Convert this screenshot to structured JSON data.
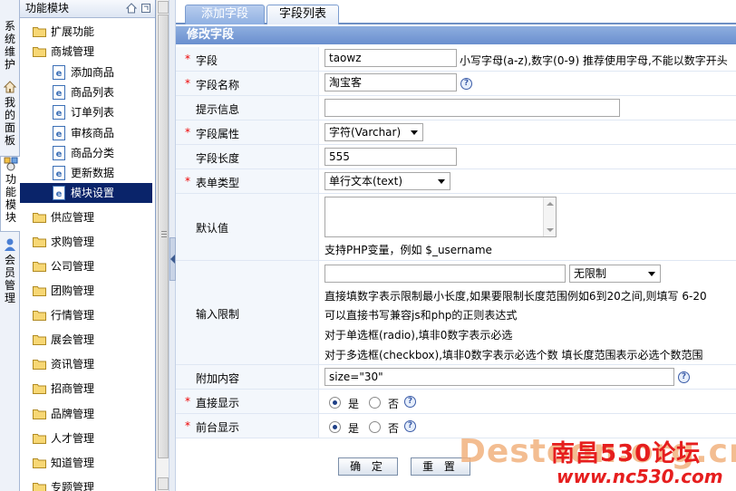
{
  "side_tabs": [
    {
      "label": "系统维护"
    },
    {
      "label": "我的面板"
    },
    {
      "label": "功能模块"
    },
    {
      "label": "会员管理"
    }
  ],
  "tree": {
    "title": "功能模块",
    "items": [
      {
        "label": "扩展功能",
        "type": "folder",
        "level": 0
      },
      {
        "label": "商城管理",
        "type": "folder",
        "level": 0
      },
      {
        "label": "添加商品",
        "type": "page",
        "level": 1
      },
      {
        "label": "商品列表",
        "type": "page",
        "level": 1
      },
      {
        "label": "订单列表",
        "type": "page",
        "level": 1
      },
      {
        "label": "审核商品",
        "type": "page",
        "level": 1
      },
      {
        "label": "商品分类",
        "type": "page",
        "level": 1
      },
      {
        "label": "更新数据",
        "type": "page",
        "level": 1
      },
      {
        "label": "模块设置",
        "type": "page",
        "level": 1,
        "selected": true
      },
      {
        "label": "供应管理",
        "type": "folder",
        "level": 0
      },
      {
        "label": "求购管理",
        "type": "folder",
        "level": 0
      },
      {
        "label": "公司管理",
        "type": "folder",
        "level": 0
      },
      {
        "label": "团购管理",
        "type": "folder",
        "level": 0
      },
      {
        "label": "行情管理",
        "type": "folder",
        "level": 0
      },
      {
        "label": "展会管理",
        "type": "folder",
        "level": 0
      },
      {
        "label": "资讯管理",
        "type": "folder",
        "level": 0
      },
      {
        "label": "招商管理",
        "type": "folder",
        "level": 0
      },
      {
        "label": "品牌管理",
        "type": "folder",
        "level": 0
      },
      {
        "label": "人才管理",
        "type": "folder",
        "level": 0
      },
      {
        "label": "知道管理",
        "type": "folder",
        "level": 0
      },
      {
        "label": "专题管理",
        "type": "folder",
        "level": 0
      }
    ]
  },
  "tabs": [
    {
      "label": "添加字段"
    },
    {
      "label": "字段列表"
    }
  ],
  "section_title": "修改字段",
  "form": {
    "field": {
      "label": "字段",
      "value": "taowz",
      "hint": "小写字母(a-z),数字(0-9) 推荐使用字母,不能以数字开头"
    },
    "field_name": {
      "label": "字段名称",
      "value": "淘宝客"
    },
    "tip": {
      "label": "提示信息",
      "value": ""
    },
    "attr": {
      "label": "字段属性",
      "value": "字符(Varchar)"
    },
    "length": {
      "label": "字段长度",
      "value": "555"
    },
    "form_type": {
      "label": "表单类型",
      "value": "单行文本(text)"
    },
    "default": {
      "label": "默认值",
      "hint": "支持PHP变量，例如 $_username"
    },
    "limit": {
      "label": "输入限制",
      "select_value": "无限制",
      "hints": [
        "直接填数字表示限制最小长度,如果要限制长度范围例如6到20之间,则填写  6-20",
        "可以直接书写兼容js和php的正则表达式",
        "对于单选框(radio),填非0数字表示必选",
        "对于多选框(checkbox),填非0数字表示必选个数 填长度范围表示必选个数范围"
      ]
    },
    "extra": {
      "label": "附加内容",
      "value": "size=\"30\""
    },
    "direct_show": {
      "label": "直接显示",
      "yes": "是",
      "no": "否"
    },
    "front_show": {
      "label": "前台显示",
      "yes": "是",
      "no": "否"
    }
  },
  "buttons": {
    "ok": "确 定",
    "reset": "重 置"
  },
  "watermark": {
    "en": "Destoon.org.cn",
    "cn": "南昌530论坛",
    "url": "www.nc530.com"
  }
}
